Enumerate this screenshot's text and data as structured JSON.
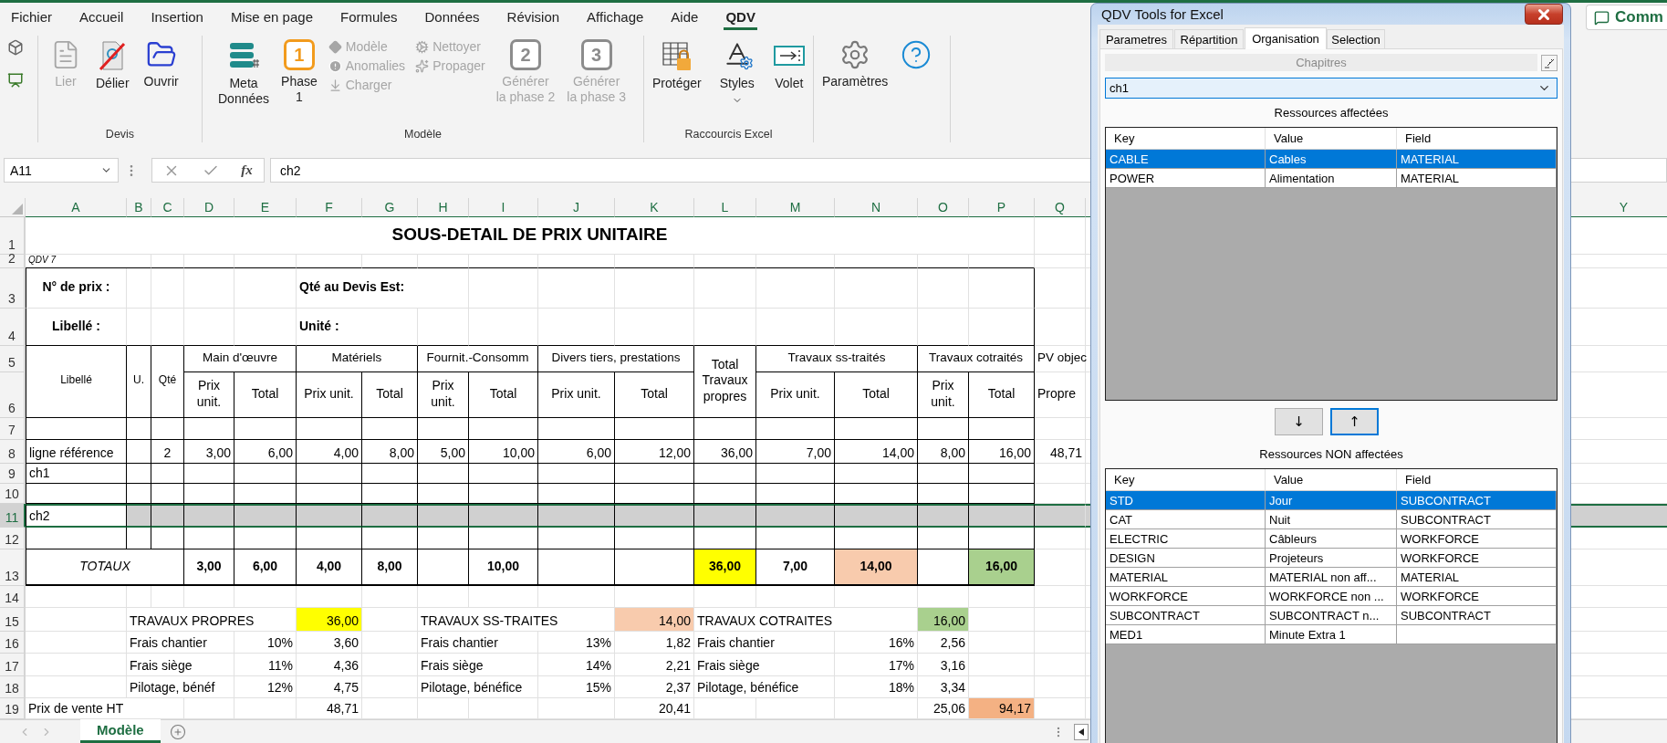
{
  "ribbon": {
    "tabs": [
      {
        "label": "Fichier",
        "selected": false
      },
      {
        "label": "Accueil",
        "selected": false
      },
      {
        "label": "Insertion",
        "selected": false
      },
      {
        "label": "Mise en page",
        "selected": false
      },
      {
        "label": "Formules",
        "selected": false
      },
      {
        "label": "Données",
        "selected": false
      },
      {
        "label": "Révision",
        "selected": false
      },
      {
        "label": "Affichage",
        "selected": false
      },
      {
        "label": "Aide",
        "selected": false
      },
      {
        "label": "QDV",
        "selected": true
      }
    ],
    "comments_button": "Comm",
    "groups": [
      {
        "label": "Devis",
        "items": [
          {
            "kind": "large",
            "label": "Lier",
            "disabled": true
          },
          {
            "kind": "large",
            "label": "Délier",
            "disabled": false
          },
          {
            "kind": "large",
            "label": "Ouvrir",
            "disabled": false
          }
        ]
      },
      {
        "label": "Modèle",
        "items": [
          {
            "kind": "large",
            "label": "Meta\nDonnées",
            "disabled": false
          },
          {
            "kind": "badge",
            "badge": "1",
            "label": "Phase\n1",
            "disabled": false
          },
          {
            "kind": "stack",
            "entries": [
              {
                "label": "Modèle",
                "disabled": true
              },
              {
                "label": "Anomalies",
                "disabled": true
              },
              {
                "label": "Charger",
                "disabled": true
              }
            ]
          },
          {
            "kind": "stack",
            "entries": [
              {
                "label": "Nettoyer",
                "disabled": true
              },
              {
                "label": "Propager",
                "disabled": true
              }
            ]
          },
          {
            "kind": "badge",
            "badge": "2",
            "label": "Générer\nla phase 2",
            "disabled": true
          },
          {
            "kind": "badge",
            "badge": "3",
            "label": "Générer\nla phase 3",
            "disabled": true
          }
        ]
      },
      {
        "label": "Raccourcis Excel",
        "items": [
          {
            "kind": "large",
            "label": "Protéger",
            "disabled": false
          },
          {
            "kind": "menu",
            "label": "Styles",
            "disabled": false
          },
          {
            "kind": "large",
            "label": "Volet",
            "disabled": false
          }
        ]
      },
      {
        "items": [
          {
            "kind": "large",
            "label": "Paramètres",
            "disabled": false
          },
          {
            "kind": "icon",
            "disabled": false
          }
        ]
      }
    ]
  },
  "formula_bar": {
    "name_box": "A11",
    "insert_function": "fx",
    "formula": "ch2"
  },
  "sheet": {
    "columns": [
      "A",
      "B",
      "C",
      "D",
      "E",
      "F",
      "G",
      "H",
      "I",
      "J",
      "K",
      "L",
      "M",
      "N",
      "O",
      "P",
      "Q",
      "Y"
    ],
    "rows": [
      {
        "number": "1",
        "selected": false,
        "cells": [
          "SOUS-DETAIL DE PRIX UNITAIRE"
        ]
      },
      {
        "number": "2",
        "selected": false,
        "cells": [
          "QDV 7"
        ]
      },
      {
        "number": "3",
        "selected": false,
        "cells": [
          "N° de prix :",
          "Qté au Devis Est:"
        ]
      },
      {
        "number": "4",
        "selected": false,
        "cells": [
          "Libellé :",
          "Unité :"
        ]
      },
      {
        "number": "5",
        "selected": false,
        "cells": [
          "Libellé",
          "U.",
          "Qté",
          "Main d'œuvre",
          "Matériels",
          "Fournit.-Consomm",
          "Divers tiers, prestations",
          "Total Travaux propres",
          "Travaux ss-traités",
          "Travaux cotraités",
          "PV objec"
        ]
      },
      {
        "number": "6",
        "selected": false,
        "cells": [
          "Prix unit.",
          "Total",
          "Prix unit.",
          "Total",
          "Prix unit.",
          "Total",
          "Prix unit.",
          "Total",
          "Prix unit.",
          "Total",
          "Prix unit.",
          "Total",
          "Propre"
        ]
      },
      {
        "number": "7",
        "selected": false
      },
      {
        "number": "8",
        "selected": false,
        "cells": [
          "ligne référence",
          "2",
          "3,00",
          "6,00",
          "4,00",
          "8,00",
          "5,00",
          "10,00",
          "6,00",
          "12,00",
          "36,00",
          "7,00",
          "14,00",
          "8,00",
          "16,00",
          "48,71"
        ]
      },
      {
        "number": "9",
        "selected": false,
        "cells": [
          "ch1"
        ]
      },
      {
        "number": "10",
        "selected": false
      },
      {
        "number": "11",
        "selected": true,
        "cells": [
          "ch2"
        ]
      },
      {
        "number": "12",
        "selected": false
      },
      {
        "number": "13",
        "selected": false,
        "cells": [
          "TOTAUX",
          "3,00",
          "6,00",
          "4,00",
          "8,00",
          "10,00",
          "36,00",
          "7,00",
          "14,00",
          "16,00"
        ]
      },
      {
        "number": "14",
        "selected": false
      },
      {
        "number": "15",
        "selected": false,
        "cells": [
          "TRAVAUX PROPRES",
          "36,00",
          "TRAVAUX SS-TRAITES",
          "14,00",
          "TRAVAUX COTRAITES",
          "16,00"
        ]
      },
      {
        "number": "16",
        "selected": false,
        "cells": [
          "Frais chantier",
          "10%",
          "3,60",
          "Frais chantier",
          "13%",
          "1,82",
          "Frais chantier",
          "16%",
          "2,56"
        ]
      },
      {
        "number": "17",
        "selected": false,
        "cells": [
          "Frais siège",
          "11%",
          "4,36",
          "Frais siège",
          "14%",
          "2,21",
          "Frais siège",
          "17%",
          "3,16"
        ]
      },
      {
        "number": "18",
        "selected": false,
        "cells": [
          "Pilotage, bénéf",
          "12%",
          "4,75",
          "Pilotage, bénéfice",
          "15%",
          "2,37",
          "Pilotage, bénéfice",
          "18%",
          "3,34"
        ]
      },
      {
        "number": "19",
        "selected": false,
        "cells": [
          "Prix de vente HT",
          "48,71",
          "20,41",
          "25,06",
          "94,17"
        ]
      }
    ],
    "tabs": [
      {
        "label": "Modèle",
        "selected": true
      }
    ]
  },
  "dialog": {
    "title": "QDV Tools for Excel",
    "tabs": [
      {
        "label": "Parametres",
        "selected": false
      },
      {
        "label": "Répartition",
        "selected": false
      },
      {
        "label": "Organisation",
        "selected": true
      },
      {
        "label": "Selection",
        "selected": false
      }
    ],
    "chapters_label": "Chapitres",
    "chapter": "ch1",
    "assigned": {
      "title": "Ressources affectées",
      "columns": [
        "Key",
        "Value",
        "Field"
      ],
      "rows": [
        {
          "cells": [
            "CABLE",
            "Cables",
            "MATERIAL"
          ],
          "selected": true
        },
        {
          "cells": [
            "POWER",
            "Alimentation",
            "MATERIAL"
          ],
          "selected": false
        }
      ]
    },
    "move_buttons": [
      {
        "label": "↓",
        "focused": false
      },
      {
        "label": "↑",
        "focused": true
      }
    ],
    "unassigned": {
      "title": "Ressources NON affectées",
      "columns": [
        "Key",
        "Value",
        "Field"
      ],
      "rows": [
        {
          "cells": [
            "STD",
            "Jour",
            "SUBCONTRACT"
          ],
          "selected": true
        },
        {
          "cells": [
            "CAT",
            "Nuit",
            "SUBCONTRACT"
          ],
          "selected": false
        },
        {
          "cells": [
            "ELECTRIC",
            "Câbleurs",
            "WORKFORCE"
          ],
          "selected": false
        },
        {
          "cells": [
            "DESIGN",
            "Projeteurs",
            "WORKFORCE"
          ],
          "selected": false
        },
        {
          "cells": [
            "MATERIAL",
            "MATERIAL non aff...",
            "MATERIAL"
          ],
          "selected": false
        },
        {
          "cells": [
            "WORKFORCE",
            "WORKFORCE non ...",
            "WORKFORCE"
          ],
          "selected": false
        },
        {
          "cells": [
            "SUBCONTRACT",
            "SUBCONTRACT n...",
            "SUBCONTRACT"
          ],
          "selected": false
        },
        {
          "cells": [
            "MED1",
            "Minute Extra 1"
          ],
          "selected": false
        }
      ]
    }
  }
}
